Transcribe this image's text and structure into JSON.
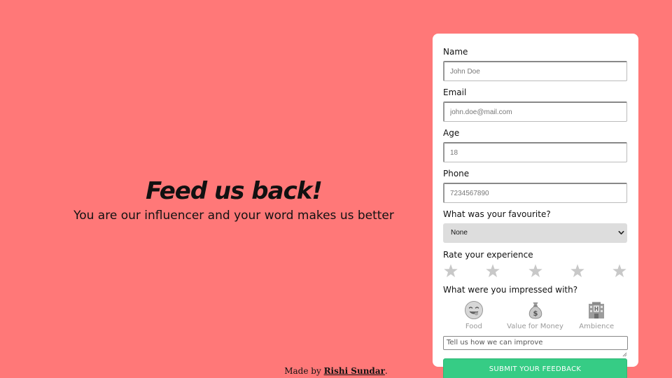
{
  "hero": {
    "title": "Feed us back!",
    "subtitle": "You are our influencer and your word makes us better"
  },
  "form": {
    "name": {
      "label": "Name",
      "placeholder": "John Doe"
    },
    "email": {
      "label": "Email",
      "placeholder": "john.doe@mail.com"
    },
    "age": {
      "label": "Age",
      "placeholder": "18"
    },
    "phone": {
      "label": "Phone",
      "placeholder": "7234567890"
    },
    "favourite": {
      "label": "What was your favourite?",
      "selected": "None"
    },
    "rating": {
      "label": "Rate your experience",
      "max_stars": 5,
      "value": 0,
      "star_color": "#c8c8c8"
    },
    "impressed": {
      "label": "What were you impressed with?",
      "options": [
        {
          "label": "Food",
          "icon": "savoring-face-icon"
        },
        {
          "label": "Value for Money",
          "icon": "money-bag-icon"
        },
        {
          "label": "Ambience",
          "icon": "hotel-icon"
        }
      ]
    },
    "comment": {
      "placeholder": "Tell us how we can improve"
    },
    "submit_label": "SUBMIT YOUR FEEDBACK"
  },
  "footer": {
    "prefix": "Made by ",
    "author": "Rishi Sundar",
    "suffix": "."
  },
  "colors": {
    "background": "#ff7878",
    "card": "#ffffff",
    "submit": "#36cc85",
    "select_bg": "#dddddd"
  }
}
